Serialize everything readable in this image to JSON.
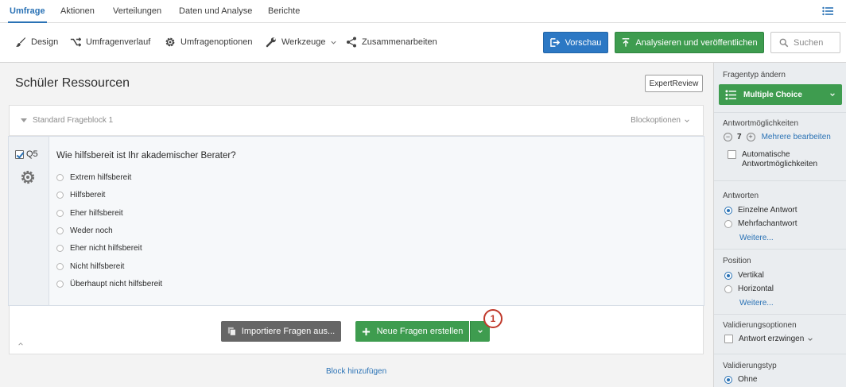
{
  "topnav": {
    "tabs": [
      {
        "label": "Umfrage",
        "active": true
      },
      {
        "label": "Aktionen"
      },
      {
        "label": "Verteilungen"
      },
      {
        "label": "Daten und Analyse"
      },
      {
        "label": "Berichte"
      }
    ],
    "right_icon": "list-icon"
  },
  "toolbar": {
    "design": "Design",
    "history": "Umfragenverlauf",
    "options": "Umfragenoptionen",
    "tools": "Werkzeuge",
    "collaborate": "Zusammenarbeiten",
    "preview": "Vorschau",
    "publish": "Analysieren und veröffentlichen",
    "search_placeholder": "Suchen",
    "accent_blue": "#2c78c4",
    "accent_green": "#3e9c4f"
  },
  "survey": {
    "title": "Schüler Ressourcen",
    "expert_review": "ExpertReview",
    "block": {
      "title": "Standard Frageblock 1",
      "options": "Blockoptionen"
    },
    "question": {
      "number": "Q5",
      "text": "Wie hilfsbereit ist Ihr akademischer Berater?",
      "choices": [
        "Extrem hilfsbereit",
        "Hilfsbereit",
        "Eher hilfsbereit",
        "Weder noch",
        "Eher nicht hilfsbereit",
        "Nicht hilfsbereit",
        "Überhaupt nicht hilfsbereit"
      ]
    },
    "import_button": "Importiere Fragen aus...",
    "new_button": "Neue Fragen erstellen",
    "callout": "1",
    "add_block": "Block hinzufügen"
  },
  "panel": {
    "change_type_label": "Fragentyp ändern",
    "question_type": "Multiple Choice",
    "choices_label": "Antwortmöglichkeiten",
    "choice_count": "7",
    "edit_multiple": "Mehrere bearbeiten",
    "auto_choices_line1": "Automatische",
    "auto_choices_line2": "Antwortmöglichkeiten",
    "answers_label": "Antworten",
    "single_answer": "Einzelne Antwort",
    "multi_answer": "Mehrfachantwort",
    "more1": "Weitere...",
    "position_label": "Position",
    "vertical": "Vertikal",
    "horizontal": "Horizontal",
    "more2": "Weitere...",
    "validation_options_label": "Validierungsoptionen",
    "force_response": "Antwort erzwingen",
    "validation_type_label": "Validierungstyp",
    "none": "Ohne"
  }
}
